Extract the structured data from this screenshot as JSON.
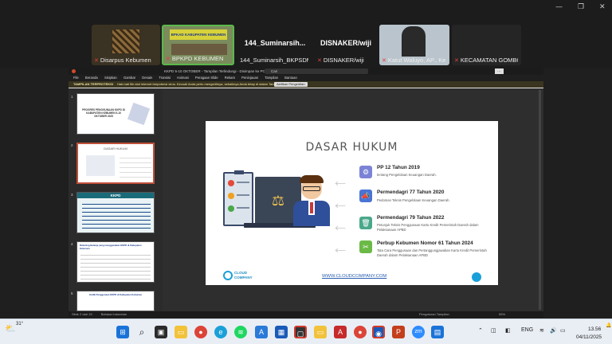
{
  "participants": [
    {
      "name": "Disarpus Kebumen",
      "big": ""
    },
    {
      "name": "BPKPD KEBUMEN",
      "big": ""
    },
    {
      "name": "144_Suminarsih_BKPSDM",
      "big": "144_Suminarsih..."
    },
    {
      "name": "DISNAKER/wiji",
      "big": "DISNAKER/wiji"
    },
    {
      "name": "Katut Waluyo, AP., Ke...",
      "big": ""
    },
    {
      "name": "KECAMATAN GOMBO...",
      "big": ""
    }
  ],
  "banner_text": "BPKAD KABUPATEN KEBUMEN",
  "ppt": {
    "title": "KKPD 5-10 OKTOBER  - Tampilan Terlindungi  - Disimpan ke PC Ini",
    "search": "Cari",
    "menu": [
      "File",
      "Beranda",
      "Sisipkan",
      "Gambar",
      "Desain",
      "Transisi",
      "Animasi",
      "Peragaan Slide",
      "Rekam",
      "Peninjauan",
      "Tampilan",
      "Bantuan"
    ],
    "warning_label": "TAMPILAN TERPROTEKSI",
    "warning_text": "Hati-hati file dari internet berpotensi virus. Kecuali Anda perlu mengeditnya, sebaiknya Anda tetap di dalam Tampilan Terproteksi.",
    "warning_button": "Aktifkan Pengeditan",
    "status_left": "Slide 2 dari 19",
    "status_lang": "Bahasa Indonesia",
    "status_right": "Pengaturan Tampilan",
    "zoom": "59%"
  },
  "thumbs": [
    {
      "n": "1",
      "title": "PROGRES PENGGUNAAN KKPD DI KABUPATEN KEBUMEN 5-10 OKTOBER 2025"
    },
    {
      "n": "2",
      "title": "DASAR HUKUM"
    },
    {
      "n": "3",
      "title": "KKPD"
    },
    {
      "n": "4",
      "title": "Rekening Belanja yang menggunakan KKPD di Kabupaten Kebumen"
    },
    {
      "n": "5",
      "title": "Grafik Penggunaan KKPD di Kabupaten Kebumen"
    }
  ],
  "slide": {
    "title": "DASAR HUKUM",
    "items": [
      {
        "title": "PP 12 Tahun 2019",
        "sub": "tentang Pengelolaan Keuangan Daerah.",
        "icon": "settings-icon",
        "color": "#7b83d6"
      },
      {
        "title": "Permendagri 77 Tahun 2020",
        "sub": "Pedoman Teknis Pengelolaan Keuangan Daerah.",
        "icon": "megaphone-icon",
        "color": "#4a74d4"
      },
      {
        "title": "Permendagri 79 Tahun 2022",
        "sub": "Petunjuk Teknis Penggunaan Kartu Kredit Pemerintah Daerah dalam Pelaksanaan APBD",
        "icon": "trash-icon",
        "color": "#4aa88a"
      },
      {
        "title": "Perbup Kebumen Nomor 61 Tahun 2024",
        "sub": "Tata Cara Penggunaan dan Pertanggungjawaban Kartu Kredit Pemerintah Daerah dalam Pelaksanaan APBD",
        "icon": "tools-icon",
        "color": "#6bb946"
      }
    ],
    "logo": "CLOUD COMPANY",
    "url": "WWW.CLOUDCOMPANY.COM"
  },
  "taskbar": {
    "weather": "31°",
    "lang": "ENG",
    "time": "13.56",
    "date": "04/11/2025"
  },
  "window_controls": {
    "minimize": "—",
    "restore": "❐",
    "close": "✕"
  }
}
